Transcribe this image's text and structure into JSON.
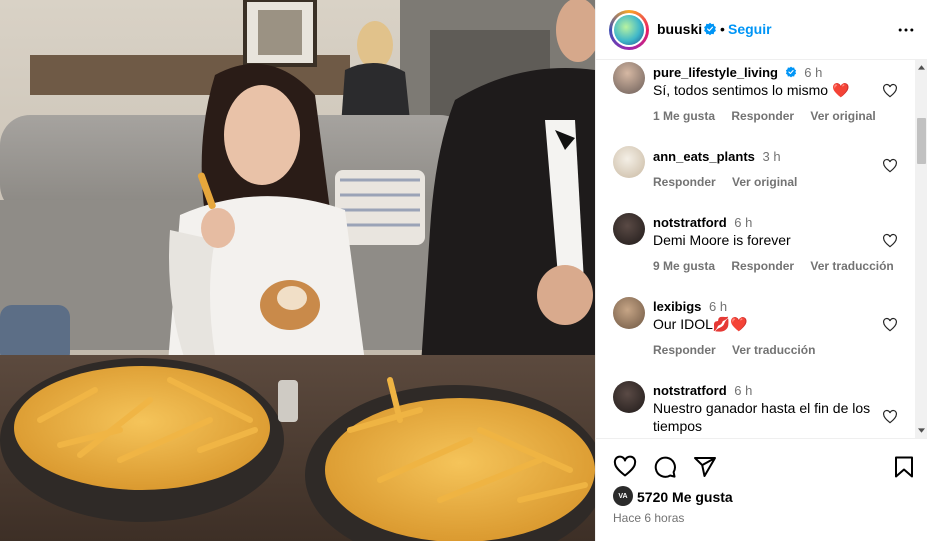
{
  "post": {
    "username": "buuski",
    "follow_label": "Seguir",
    "dot": "•",
    "likes_count_text": "5720 Me gusta",
    "likes_avatar_text": "VA",
    "time_ago": "Hace 6 horas"
  },
  "comments": [
    {
      "username": "pure_lifestyle_living",
      "verified": true,
      "time": "6 h",
      "text": "Sí, todos sentimos lo mismo ❤️",
      "actions": [
        "1 Me gusta",
        "Responder",
        "Ver original"
      ]
    },
    {
      "username": "ann_eats_plants",
      "verified": false,
      "time": "3 h",
      "text": "",
      "actions": [
        "Responder",
        "Ver original"
      ]
    },
    {
      "username": "notstratford",
      "verified": false,
      "time": "6 h",
      "text": "Demi Moore is forever",
      "actions": [
        "9 Me gusta",
        "Responder",
        "Ver traducción"
      ]
    },
    {
      "username": "lexibigs",
      "verified": false,
      "time": "6 h",
      "text": "Our IDOL💋❤️",
      "actions": [
        "Responder",
        "Ver traducción"
      ]
    },
    {
      "username": "notstratford",
      "verified": false,
      "time": "6 h",
      "text": "Nuestro ganador hasta el fin de los tiempos",
      "actions": []
    }
  ],
  "icons": {
    "verified": "verified-badge-icon",
    "more": "more-options-icon",
    "like": "heart-icon",
    "comment": "comment-icon",
    "share": "share-icon",
    "save": "bookmark-icon"
  },
  "colors": {
    "accent": "#0095f6",
    "secondary_text": "#737373",
    "heart": "#ed4956"
  }
}
